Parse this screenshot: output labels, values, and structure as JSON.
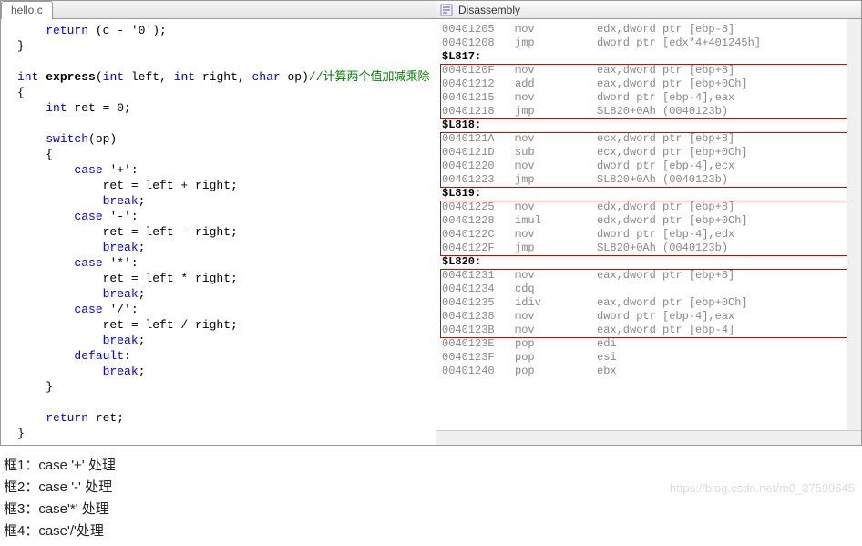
{
  "left": {
    "tab": "hello.c",
    "code": [
      [
        [
          ""
        ],
        [
          "    "
        ],
        [
          "kw",
          "return"
        ],
        [
          " (c - "
        ],
        [
          "ch",
          "'0'"
        ],
        [
          ");"
        ]
      ],
      [
        [
          "}"
        ]
      ],
      [
        [
          ""
        ]
      ],
      [
        [
          "ty",
          "int"
        ],
        [
          " "
        ],
        [
          "b",
          "express"
        ],
        [
          "("
        ],
        [
          "ty",
          "int"
        ],
        [
          " left, "
        ],
        [
          "ty",
          "int"
        ],
        [
          " right, "
        ],
        [
          "ty",
          "char"
        ],
        [
          " op)"
        ],
        [
          "cm",
          "//计算两个值加减乘除"
        ]
      ],
      [
        [
          "{"
        ]
      ],
      [
        [
          "    "
        ],
        [
          "ty",
          "int"
        ],
        [
          " ret = "
        ],
        [
          "ch",
          "0"
        ],
        [
          ";"
        ]
      ],
      [
        [
          ""
        ]
      ],
      [
        [
          "    "
        ],
        [
          "kw",
          "switch"
        ],
        [
          "(op)"
        ]
      ],
      [
        [
          "    {"
        ]
      ],
      [
        [
          "        "
        ],
        [
          "kw",
          "case"
        ],
        [
          " "
        ],
        [
          "ch",
          "'+'"
        ],
        [
          ":"
        ]
      ],
      [
        [
          "            ret = left + right;"
        ]
      ],
      [
        [
          "            "
        ],
        [
          "kw",
          "break"
        ],
        [
          ";"
        ]
      ],
      [
        [
          "        "
        ],
        [
          "kw",
          "case"
        ],
        [
          " "
        ],
        [
          "ch",
          "'-'"
        ],
        [
          ":"
        ]
      ],
      [
        [
          "            ret = left - right;"
        ]
      ],
      [
        [
          "            "
        ],
        [
          "kw",
          "break"
        ],
        [
          ";"
        ]
      ],
      [
        [
          "        "
        ],
        [
          "kw",
          "case"
        ],
        [
          " "
        ],
        [
          "ch",
          "'*'"
        ],
        [
          ":"
        ]
      ],
      [
        [
          "            ret = left * right;"
        ]
      ],
      [
        [
          "            "
        ],
        [
          "kw",
          "break"
        ],
        [
          ";"
        ]
      ],
      [
        [
          "        "
        ],
        [
          "kw",
          "case"
        ],
        [
          " "
        ],
        [
          "ch",
          "'/'"
        ],
        [
          ":"
        ]
      ],
      [
        [
          "            ret = left / right;"
        ]
      ],
      [
        [
          "            "
        ],
        [
          "kw",
          "break"
        ],
        [
          ";"
        ]
      ],
      [
        [
          "        "
        ],
        [
          "kw",
          "default"
        ],
        [
          ":"
        ]
      ],
      [
        [
          "            "
        ],
        [
          "kw",
          "break"
        ],
        [
          ";"
        ]
      ],
      [
        [
          "    }"
        ]
      ],
      [
        [
          ""
        ]
      ],
      [
        [
          "    "
        ],
        [
          "kw",
          "return"
        ],
        [
          " ret;"
        ]
      ],
      [
        [
          "}"
        ]
      ]
    ]
  },
  "right": {
    "title": "Disassembly",
    "rows": [
      {
        "addr": "00401205",
        "mn": "mov",
        "op": "edx,dword ptr [ebp-8]"
      },
      {
        "addr": "00401208",
        "mn": "jmp",
        "op": "dword ptr [edx*4+401245h]"
      },
      {
        "lbl": "$L817:"
      },
      {
        "addr": "0040120F",
        "mn": "mov",
        "op": "eax,dword ptr [ebp+8]"
      },
      {
        "addr": "00401212",
        "mn": "add",
        "op": "eax,dword ptr [ebp+0Ch]"
      },
      {
        "addr": "00401215",
        "mn": "mov",
        "op": "dword ptr [ebp-4],eax"
      },
      {
        "addr": "00401218",
        "mn": "jmp",
        "op": "$L820+0Ah (0040123b)"
      },
      {
        "lbl": "$L818:"
      },
      {
        "addr": "0040121A",
        "mn": "mov",
        "op": "ecx,dword ptr [ebp+8]"
      },
      {
        "addr": "0040121D",
        "mn": "sub",
        "op": "ecx,dword ptr [ebp+0Ch]"
      },
      {
        "addr": "00401220",
        "mn": "mov",
        "op": "dword ptr [ebp-4],ecx"
      },
      {
        "addr": "00401223",
        "mn": "jmp",
        "op": "$L820+0Ah (0040123b)"
      },
      {
        "lbl": "$L819:"
      },
      {
        "addr": "00401225",
        "mn": "mov",
        "op": "edx,dword ptr [ebp+8]"
      },
      {
        "addr": "00401228",
        "mn": "imul",
        "op": "edx,dword ptr [ebp+0Ch]"
      },
      {
        "addr": "0040122C",
        "mn": "mov",
        "op": "dword ptr [ebp-4],edx"
      },
      {
        "addr": "0040122F",
        "mn": "jmp",
        "op": "$L820+0Ah (0040123b)"
      },
      {
        "lbl": "$L820:"
      },
      {
        "addr": "00401231",
        "mn": "mov",
        "op": "eax,dword ptr [ebp+8]"
      },
      {
        "addr": "00401234",
        "mn": "cdq",
        "op": ""
      },
      {
        "addr": "00401235",
        "mn": "idiv",
        "op": "eax,dword ptr [ebp+0Ch]"
      },
      {
        "addr": "00401238",
        "mn": "mov",
        "op": "dword ptr [ebp-4],eax"
      },
      {
        "addr": "0040123B",
        "mn": "mov",
        "op": "eax,dword ptr [ebp-4]"
      },
      {
        "addr": "0040123E",
        "mn": "pop",
        "op": "edi"
      },
      {
        "addr": "0040123F",
        "mn": "pop",
        "op": "esi"
      },
      {
        "addr": "00401240",
        "mn": "pop",
        "op": "ebx"
      }
    ]
  },
  "notes": [
    "框1：case '+' 处理",
    "框2：case '-' 处理",
    "框3：case'*' 处理",
    "框4：case'/'处理"
  ],
  "watermark": "https://blog.csdn.net/m0_37599645"
}
